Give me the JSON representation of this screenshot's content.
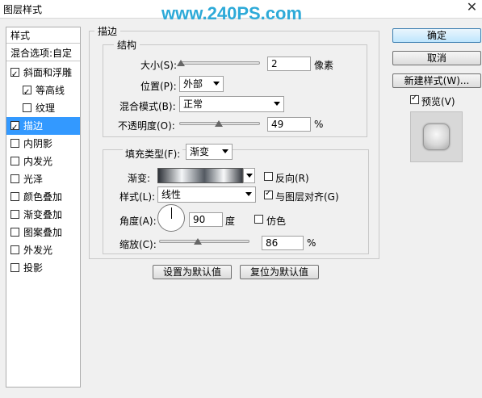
{
  "window": {
    "title": "图层样式",
    "watermark": "www.240PS.com",
    "close_glyph": "✕"
  },
  "sidebar": {
    "header": "样式",
    "blend_options": "混合选项:自定",
    "items": [
      {
        "label": "斜面和浮雕",
        "checked": true
      },
      {
        "label": "等高线",
        "checked": true
      },
      {
        "label": "纹理",
        "checked": false
      },
      {
        "label": "描边",
        "checked": true
      },
      {
        "label": "内阴影",
        "checked": false
      },
      {
        "label": "内发光",
        "checked": false
      },
      {
        "label": "光泽",
        "checked": false
      },
      {
        "label": "颜色叠加",
        "checked": false
      },
      {
        "label": "渐变叠加",
        "checked": false
      },
      {
        "label": "图案叠加",
        "checked": false
      },
      {
        "label": "外发光",
        "checked": false
      },
      {
        "label": "投影",
        "checked": false
      }
    ]
  },
  "stroke": {
    "section_title": "描边",
    "structure_title": "结构",
    "size_label": "大小(S):",
    "size_value": "2",
    "size_unit": "像素",
    "size_level": 0.02,
    "position_label": "位置(P):",
    "position_value": "外部",
    "blend_label": "混合模式(B):",
    "blend_value": "正常",
    "opacity_label": "不透明度(O):",
    "opacity_value": "49",
    "opacity_unit": "%",
    "opacity_level": 0.49
  },
  "fill": {
    "fill_type_label": "填充类型(F):",
    "fill_type_value": "渐变",
    "gradient_label": "渐变:",
    "reverse_label": "反向(R)",
    "reverse_checked": false,
    "style_label": "样式(L):",
    "style_value": "线性",
    "align_label": "与图层对齐(G)",
    "align_checked": true,
    "angle_label": "角度(A):",
    "angle_value": "90",
    "angle_unit": "度",
    "dither_label": "仿色",
    "dither_checked": false,
    "scale_label": "缩放(C):",
    "scale_value": "86",
    "scale_unit": "%",
    "scale_level": 0.43
  },
  "buttons": {
    "set_default": "设置为默认值",
    "reset_default": "复位为默认值",
    "ok": "确定",
    "cancel": "取消",
    "new_style": "新建样式(W)...",
    "preview_label": "预览(V)",
    "preview_checked": true
  }
}
